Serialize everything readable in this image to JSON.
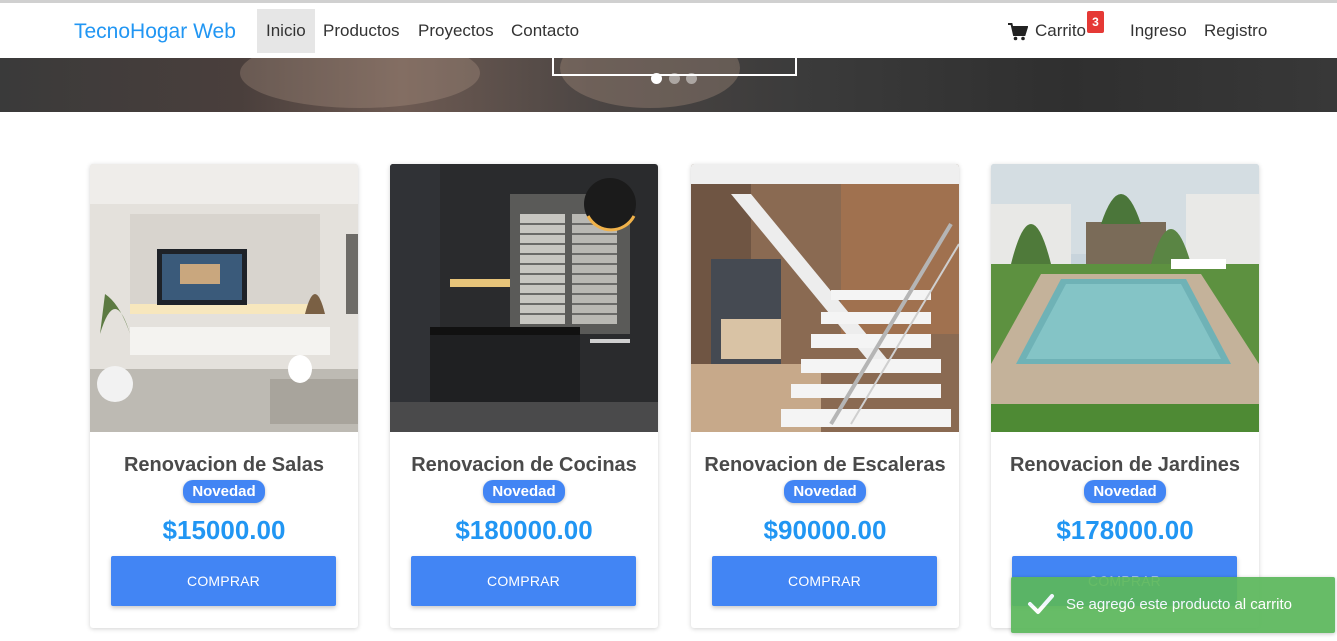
{
  "brand": "TecnoHogar Web",
  "nav": {
    "items": [
      {
        "label": "Inicio",
        "active": true
      },
      {
        "label": "Productos"
      },
      {
        "label": "Proyectos"
      },
      {
        "label": "Contacto"
      }
    ],
    "cart_label": "Carrito",
    "cart_count": "3",
    "login_label": "Ingreso",
    "register_label": "Registro"
  },
  "carousel": {
    "slides": 3,
    "active_slide": 1
  },
  "products": [
    {
      "title": "Renovacion de Salas",
      "badge": "Novedad",
      "price": "$15000.00",
      "button": "COMPRAR"
    },
    {
      "title": "Renovacion de Cocinas",
      "badge": "Novedad",
      "price": "$180000.00",
      "button": "COMPRAR"
    },
    {
      "title": "Renovacion de Escaleras",
      "badge": "Novedad",
      "price": "$90000.00",
      "button": "COMPRAR"
    },
    {
      "title": "Renovacion de Jardines",
      "badge": "Novedad",
      "price": "$178000.00",
      "button": "COMPRAR"
    }
  ],
  "toast": {
    "message": "Se agregó este producto al carrito",
    "icon": "checkmark-icon"
  },
  "colors": {
    "brand": "#2196f3",
    "button": "#4285f4",
    "badge": "#4285f4",
    "price": "#2196f3",
    "cart_badge": "#e53935",
    "toast": "#5cb85c"
  }
}
